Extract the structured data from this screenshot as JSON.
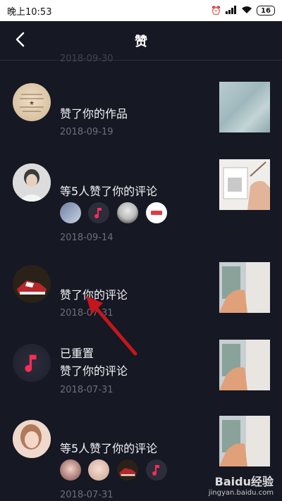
{
  "status_bar": {
    "time": "晚上10:53",
    "battery": "16"
  },
  "header": {
    "title": "赞"
  },
  "partial_date": "2018-09-30",
  "notifications": [
    {
      "line1": "赞了你的作品",
      "line2": "",
      "date": "2018-09-19"
    },
    {
      "line1": "等5人赞了你的评论",
      "line2": "",
      "date": "2018-09-14"
    },
    {
      "line1": "赞了你的评论",
      "line2": "",
      "date": "2018-07-31"
    },
    {
      "line1": "已重置",
      "line2": "赞了你的评论",
      "date": "2018-07-31"
    },
    {
      "line1": "等5人赞了你的评论",
      "line2": "",
      "date": "2018-07-31"
    }
  ],
  "watermark": {
    "brand": "Baidu经验",
    "url": "jingyan.baidu.com"
  },
  "colors": {
    "background": "#161823",
    "accent": "#fe2c55",
    "annotation_arrow": "#c4161c"
  }
}
